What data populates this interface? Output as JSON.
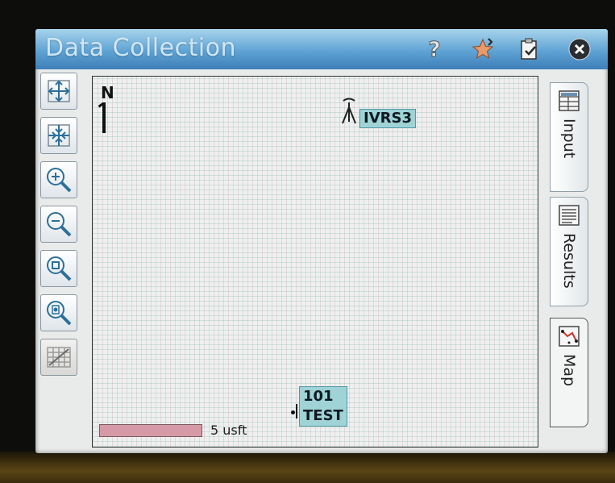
{
  "window": {
    "title": "Data Collection",
    "title_icons": [
      "help-icon",
      "favorites-star-icon",
      "clipboard-check-icon",
      "close-icon"
    ]
  },
  "toolbar": {
    "tools": [
      "zoom-extents-icon",
      "zoom-center-icon",
      "zoom-in-icon",
      "zoom-out-icon",
      "zoom-window-icon",
      "zoom-point-icon",
      "map-layers-icon"
    ]
  },
  "map": {
    "north_label": "N",
    "points": [
      {
        "id": "IVRS3",
        "kind": "control-station"
      },
      {
        "id": "101",
        "description": "TEST",
        "kind": "survey-point"
      }
    ],
    "scale": {
      "label": "5 usft"
    }
  },
  "tabs": [
    {
      "label": "Input",
      "icon": "input-table-icon",
      "active": false
    },
    {
      "label": "Results",
      "icon": "results-list-icon",
      "active": false
    },
    {
      "label": "Map",
      "icon": "map-icon",
      "active": true
    }
  ],
  "colors": {
    "titlebar": "#5fa3d4",
    "label_fill": "#9fd3d6",
    "scale_bar": "#d59aa6"
  }
}
